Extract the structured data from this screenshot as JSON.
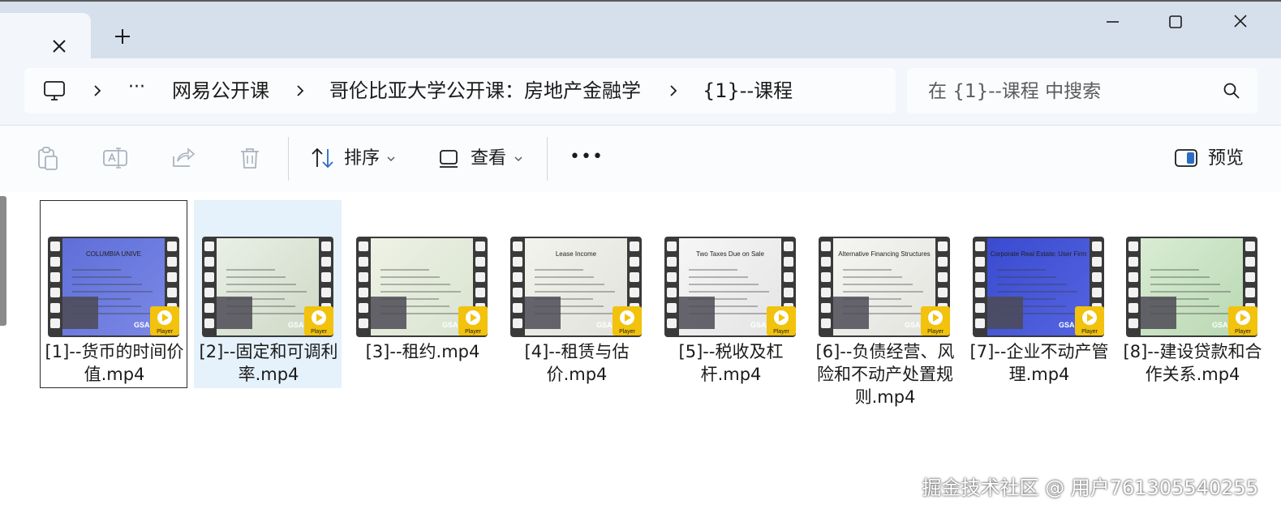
{
  "window": {
    "tab_close_icon": "close-icon",
    "new_tab_icon": "plus-icon",
    "controls": [
      "minimize-icon",
      "maximize-icon",
      "close-icon"
    ]
  },
  "breadcrumb": {
    "computer_icon": "monitor-icon",
    "more": "···",
    "items": [
      "网易公开课",
      "哥伦比亚大学公开课：房地产金融学",
      "{1}--课程"
    ]
  },
  "search": {
    "placeholder": "在 {1}--课程 中搜索"
  },
  "toolbar": {
    "sort_label": "排序",
    "view_label": "查看",
    "more_label": "•••",
    "preview_label": "预览"
  },
  "files": [
    {
      "name": "[1]--货币的时间价值.mp4",
      "thumb_text": "COLUMBIA UNIVE",
      "colors": [
        "#5f6fd8",
        "#7b88e6"
      ]
    },
    {
      "name": "[2]--固定和可调利率.mp4",
      "thumb_text": "",
      "colors": [
        "#e9efe6",
        "#cfd9c6"
      ]
    },
    {
      "name": "[3]--租约.mp4",
      "thumb_text": "",
      "colors": [
        "#eef2e6",
        "#d9e3cf"
      ]
    },
    {
      "name": "[4]--租赁与估价.mp4",
      "thumb_text": "Lease Income",
      "colors": [
        "#f3f3ee",
        "#e2e2dc"
      ]
    },
    {
      "name": "[5]--税收及杠杆.mp4",
      "thumb_text": "Two Taxes Due on Sale",
      "colors": [
        "#f6f6f6",
        "#e4e4e4"
      ]
    },
    {
      "name": "[6]--负债经营、风险和不动产处置规则.mp4",
      "thumb_text": "Alternative Financing Structures",
      "colors": [
        "#f5f5f2",
        "#e3e3de"
      ]
    },
    {
      "name": "[7]--企业不动产管理.mp4",
      "thumb_text": "Corporate Real Estate: User Firm",
      "colors": [
        "#3a4bd0",
        "#5464e0"
      ]
    },
    {
      "name": "[8]--建设贷款和合作关系.mp4",
      "thumb_text": "",
      "colors": [
        "#d9ecd4",
        "#b9d8b2"
      ]
    }
  ],
  "thumb_badge": {
    "gsa": "GSA",
    "player": "Player",
    "badge_color": "#f2c20c"
  },
  "watermark": "掘金技术社区 @ 用户761305540255"
}
